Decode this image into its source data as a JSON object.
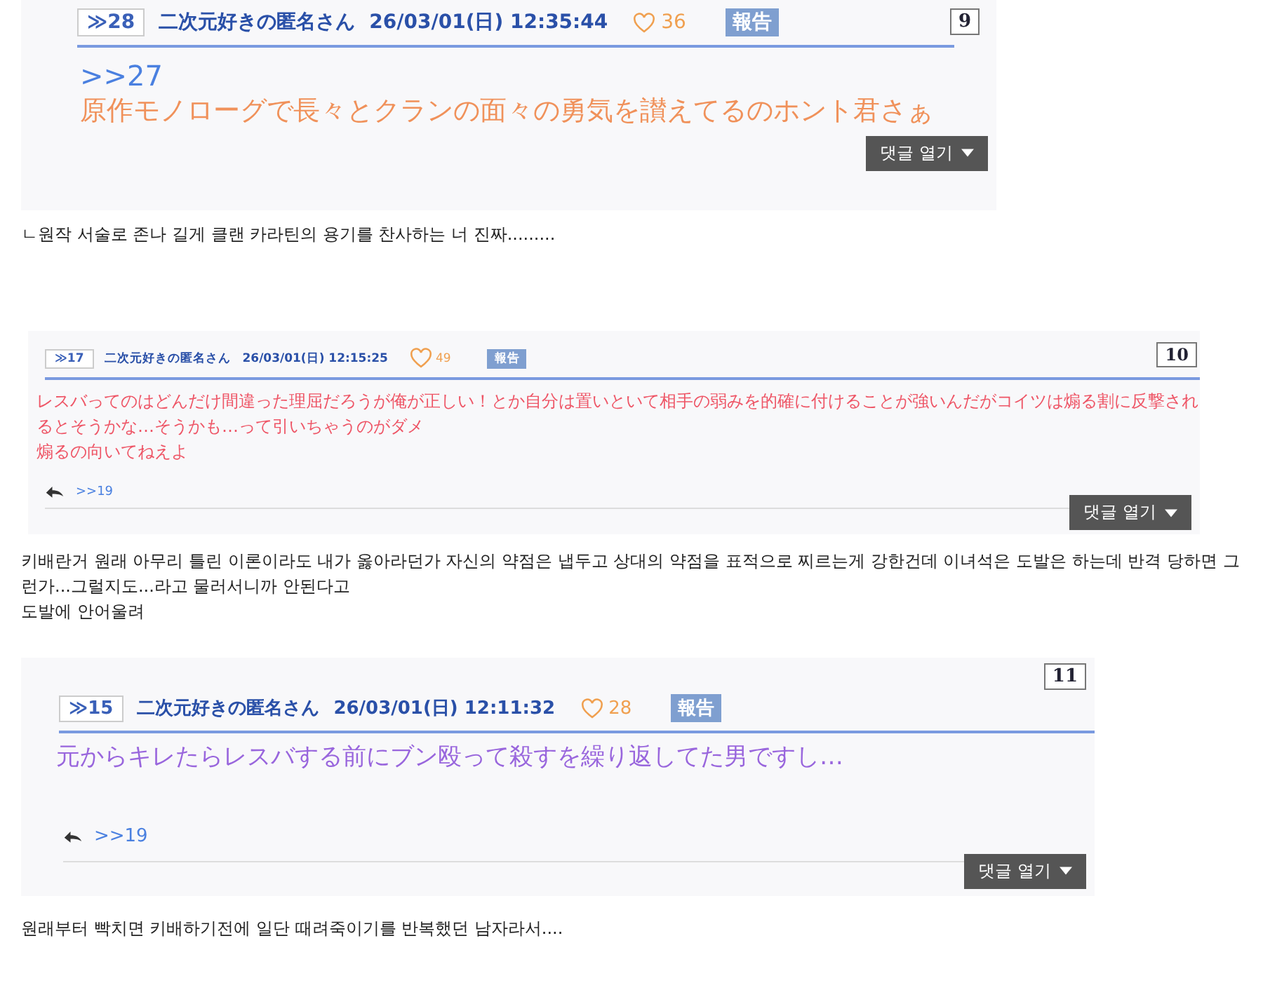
{
  "posts": [
    {
      "number": "9",
      "ref": "≫28",
      "name": "二次元好きの匿名さん",
      "date": "26/03/01(日) 12:35:44",
      "likes": "36",
      "report": "報告",
      "anchor": ">>27",
      "lines": [
        "原作モノローグで長々とクランの面々の勇気を讃えてるのホント君さぁ"
      ],
      "color": "#f0915a",
      "button": "댓글 열기",
      "caption": [
        "ㄴ원작 서술로 존나 길게 클랜 카라틴의 용기를 찬사하는 너 진짜........."
      ]
    },
    {
      "number": "10",
      "ref": "≫17",
      "name": "二次元好きの匿名さん",
      "date": "26/03/01(日) 12:15:25",
      "likes": "49",
      "report": "報告",
      "lines": [
        "レスバってのはどんだけ間違った理屈だろうが俺が正しい！とか自分は置いといて相手の弱みを的確に付けることが強いんだがコイツは煽る割に反撃されるとそうかな…そうかも…って引いちゃうのがダメ",
        "煽るの向いてねえよ"
      ],
      "color": "#ee5566",
      "reply": ">>19",
      "button": "댓글 열기",
      "caption": [
        "키배란거 원래 아무리 틀린 이론이라도 내가 옳아라던가 자신의 약점은 냅두고 상대의 약점을 표적으로 찌르는게 강한건데 이녀석은 도발은 하는데 반격 당하면 그런가...그럴지도...라고 물러서니까 안된다고",
        "도발에 안어울려"
      ]
    },
    {
      "number": "11",
      "ref": "≫15",
      "name": "二次元好きの匿名さん",
      "date": "26/03/01(日) 12:11:32",
      "likes": "28",
      "report": "報告",
      "lines": [
        "元からキレたらレスバする前にブン殴って殺すを繰り返してた男ですし…"
      ],
      "color": "#9966dd",
      "reply": ">>19",
      "button": "댓글 열기",
      "caption": [
        "원래부터 빡치면 키배하기전에 일단 때려죽이기를 반복했던 남자라서...."
      ]
    }
  ]
}
